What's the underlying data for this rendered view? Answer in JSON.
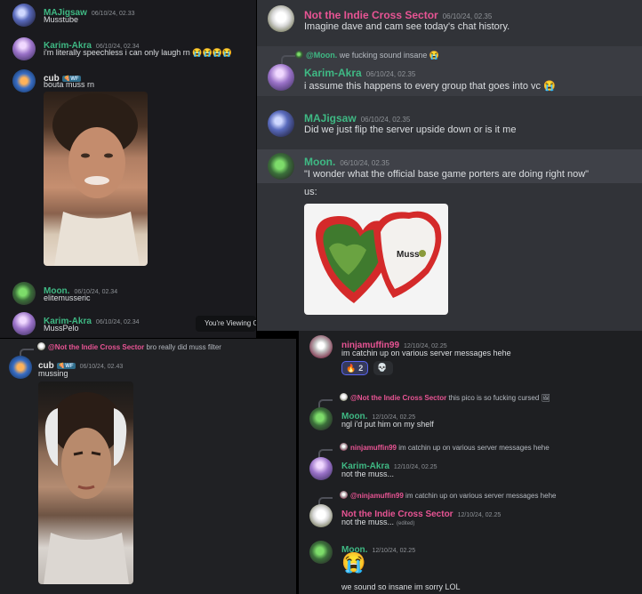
{
  "panel1": {
    "m1": {
      "author": "MAJigsaw",
      "time": "06/10/24, 02.33",
      "text": "Musstube"
    },
    "m2": {
      "author": "Karim-Akra",
      "time": "06/10/24, 02.34",
      "text": "i'm literally speechless i can only laugh rn",
      "emoji": "😭😭😭😭"
    },
    "m3": {
      "author": "cub",
      "badge": "🍕WF",
      "text": "bouta muss rn"
    },
    "m4": {
      "author": "Moon.",
      "time": "06/10/24, 02.34",
      "text": "elitemusseric"
    },
    "m5": {
      "author": "Karim-Akra",
      "time": "06/10/24, 02.34",
      "text": "MussPelo"
    },
    "toast": "You're Viewing O"
  },
  "panel2": {
    "m1": {
      "author": "Not the Indie Cross Sector",
      "time": "06/10/24, 02.35",
      "text": "Imagine dave and cam see today's chat history."
    },
    "m2": {
      "reply_author": "@Moon.",
      "reply_text": "we fucking sound insane",
      "reply_emoji": "😭",
      "author": "Karim-Akra",
      "time": "06/10/24, 02.35",
      "text": "i assume this happens to every group that goes into vc",
      "emoji": "😭"
    },
    "m3": {
      "author": "MAJigsaw",
      "time": "06/10/24, 02.35",
      "text": "Did we just flip the server upside down or is it me"
    },
    "m4": {
      "author": "Moon.",
      "time": "06/10/24, 02.35",
      "text": "\"I wonder what the official base game porters are doing right now\"",
      "text2": "us:",
      "image_label": "Muss"
    }
  },
  "panel3": {
    "m1": {
      "reply_author": "@Not the Indie Cross Sector",
      "reply_text": "bro really did muss filter",
      "author": "cub",
      "badge": "🍕WF",
      "time": "06/10/24, 02.43",
      "text": "mussing"
    }
  },
  "panel4": {
    "m1": {
      "author": "ninjamuffin99",
      "time": "12/10/24, 02.25",
      "text": "im catchin up on various server messages hehe",
      "reaction1_emoji": "🔥",
      "reaction1_count": "2",
      "reaction2_emoji": "💀"
    },
    "m2": {
      "reply_author": "@Not the Indie Cross Sector",
      "reply_text": "this pico is so fucking cursed",
      "reply_icon": "🖼",
      "author": "Moon.",
      "time": "12/10/24, 02.25",
      "text": "ngl i'd put him on my shelf"
    },
    "m3": {
      "reply_author": "ninjamuffin99",
      "reply_text": "im catchin up on various server messages hehe",
      "author": "Karim-Akra",
      "time": "12/10/24, 02.25",
      "text": "not the muss..."
    },
    "m4": {
      "reply_author": "@ninjamuffin99",
      "reply_text": "im catchin up on various server messages hehe",
      "author": "Not the Indie Cross Sector",
      "time": "12/10/24, 02.25",
      "text": "not the muss...",
      "edited": "(edited)"
    },
    "m5": {
      "author": "Moon.",
      "time": "12/10/24, 02.25",
      "emoji": "😭",
      "text": "we sound so insane im sorry LOL"
    }
  },
  "colors": {
    "green_name": "#3fb984",
    "purple_name": "#ad7bdc",
    "pink_name": "#e85494",
    "background": "#313338"
  }
}
